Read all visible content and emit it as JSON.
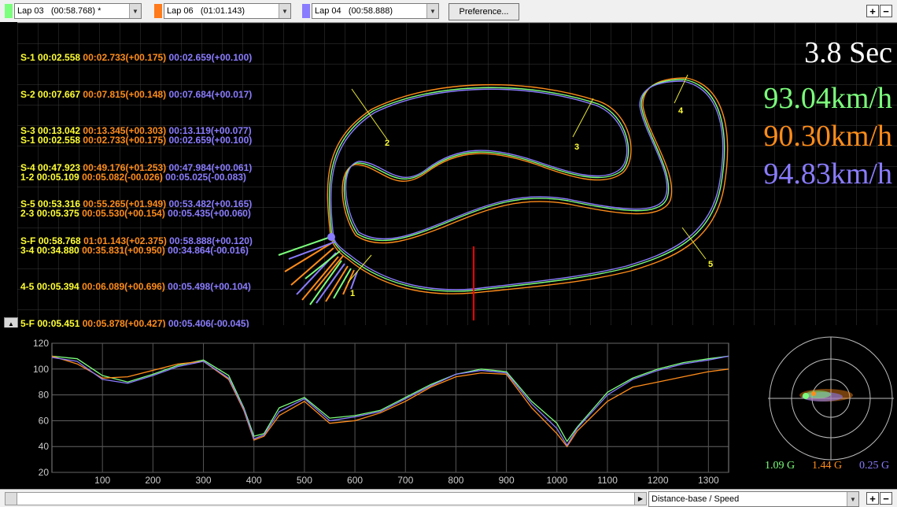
{
  "colors": {
    "lap_a": "#7cff7c",
    "lap_b": "#ff8c1a",
    "lap_c": "#8a7cff",
    "yellow": "#ffff33",
    "white": "#ffffff"
  },
  "toolbar": {
    "laps": [
      {
        "label": "Lap 03   (00:58.768) *",
        "color": "#7cff7c"
      },
      {
        "label": "Lap 06   (01:01.143)",
        "color": "#ff7a1a"
      },
      {
        "label": "Lap 04   (00:58.888)",
        "color": "#8a7cff"
      }
    ],
    "preference_label": "Preference...",
    "plus": "+",
    "minus": "−"
  },
  "splits": {
    "sectors": [
      [
        "S-1",
        "00:02.558",
        "00:02.733(+00.175)",
        "00:02.659(+00.100)"
      ],
      [
        "S-2",
        "00:07.667",
        "00:07.815(+00.148)",
        "00:07.684(+00.017)"
      ],
      [
        "S-3",
        "00:13.042",
        "00:13.345(+00.303)",
        "00:13.119(+00.077)"
      ],
      [
        "S-4",
        "00:47.923",
        "00:49.176(+01.253)",
        "00:47.984(+00.061)"
      ],
      [
        "S-5",
        "00:53.316",
        "00:55.265(+01.949)",
        "00:53.482(+00.165)"
      ],
      [
        "S-F",
        "00:58.768",
        "01:01.143(+02.375)",
        "00:58.888(+00.120)"
      ]
    ],
    "segments": [
      [
        "S-1",
        "00:02.558",
        "00:02.733(+00.175)",
        "00:02.659(+00.100)"
      ],
      [
        "1-2",
        "00:05.109",
        "00:05.082(-00.026)",
        "00:05.025(-00.083)"
      ],
      [
        "2-3",
        "00:05.375",
        "00:05.530(+00.154)",
        "00:05.435(+00.060)"
      ],
      [
        "3-4",
        "00:34.880",
        "00:35.831(+00.950)",
        "00:34.864(-00.016)"
      ],
      [
        "4-5",
        "00:05.394",
        "00:06.089(+00.696)",
        "00:05.498(+00.104)"
      ],
      [
        "5-F",
        "00:05.451",
        "00:05.878(+00.427)",
        "00:05.406(-00.045)"
      ]
    ]
  },
  "readout": {
    "time": "3.8 Sec",
    "speed_a": "93.04km/h",
    "speed_b": "90.30km/h",
    "speed_c": "94.83km/h"
  },
  "markers": [
    "1",
    "2",
    "3",
    "4",
    "5"
  ],
  "gforce": {
    "a": "1.09 G",
    "b": "1.44 G",
    "c": "0.25 G"
  },
  "chart_data": {
    "type": "line",
    "x": [
      0,
      50,
      100,
      150,
      200,
      250,
      300,
      350,
      380,
      400,
      420,
      450,
      500,
      550,
      600,
      650,
      700,
      750,
      800,
      850,
      900,
      950,
      1000,
      1020,
      1040,
      1100,
      1150,
      1200,
      1250,
      1300,
      1340
    ],
    "xlim": [
      0,
      1340
    ],
    "ylim": [
      20,
      120
    ],
    "xticks": [
      100,
      200,
      300,
      400,
      500,
      600,
      700,
      800,
      900,
      1000,
      1100,
      1200,
      1300
    ],
    "yticks": [
      20,
      40,
      60,
      80,
      100,
      120
    ],
    "series": [
      {
        "color": "#7cff7c",
        "values": [
          110,
          108,
          95,
          90,
          96,
          103,
          107,
          95,
          70,
          48,
          50,
          70,
          78,
          62,
          64,
          68,
          78,
          88,
          96,
          100,
          98,
          75,
          58,
          44,
          55,
          82,
          93,
          100,
          105,
          108,
          110
        ]
      },
      {
        "color": "#ff8c1a",
        "values": [
          110,
          104,
          93,
          94,
          99,
          104,
          106,
          92,
          68,
          45,
          48,
          64,
          75,
          58,
          60,
          66,
          75,
          86,
          94,
          97,
          96,
          70,
          50,
          40,
          52,
          75,
          86,
          90,
          94,
          98,
          100
        ]
      },
      {
        "color": "#8a7cff",
        "values": [
          109,
          106,
          92,
          89,
          95,
          102,
          106,
          93,
          69,
          46,
          49,
          67,
          77,
          60,
          63,
          67,
          77,
          87,
          96,
          99,
          97,
          73,
          54,
          41,
          54,
          80,
          92,
          99,
          104,
          107,
          110
        ]
      }
    ]
  },
  "status": {
    "mode": "Distance-base / Speed"
  }
}
